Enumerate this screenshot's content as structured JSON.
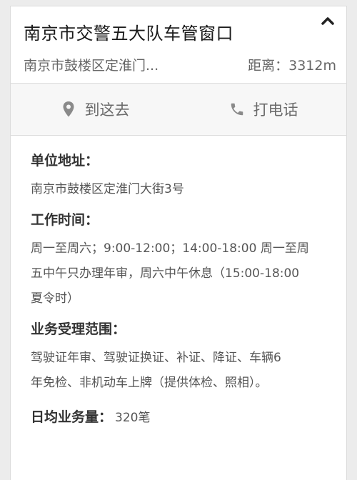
{
  "header": {
    "title": "南京市交警五大队车管窗口",
    "address_short": "南京市鼓楼区定淮门...",
    "distance": "距离：3312m"
  },
  "actions": {
    "navigate_label": "到这去",
    "call_label": "打电话"
  },
  "details": {
    "address_heading": "单位地址：",
    "address_value": "南京市鼓楼区定淮门大街3号",
    "hours_heading": "工作时间：",
    "hours_line1": "周一至周六；9:00-12:00；14:00-18:00 周一至周",
    "hours_line2": "五中午只办理年审，周六中午休息（15:00-18:00",
    "hours_line3": "夏令时）",
    "scope_heading": "业务受理范围：",
    "scope_line1": "驾驶证年审、驾驶证换证、补证、降证、车辆6",
    "scope_line2": "年免检、非机动车上牌（提供体检、照相）。",
    "volume_heading": "日均业务量：",
    "volume_value": "320笔"
  },
  "icons": {
    "collapse": "chevron-up-icon",
    "navigate": "location-pin-icon",
    "call": "phone-icon"
  },
  "colors": {
    "background": "#ececec",
    "card": "#ffffff",
    "action_bar": "#f7f7f7",
    "text_dark": "#1a1a1a",
    "text_muted": "#666666"
  }
}
